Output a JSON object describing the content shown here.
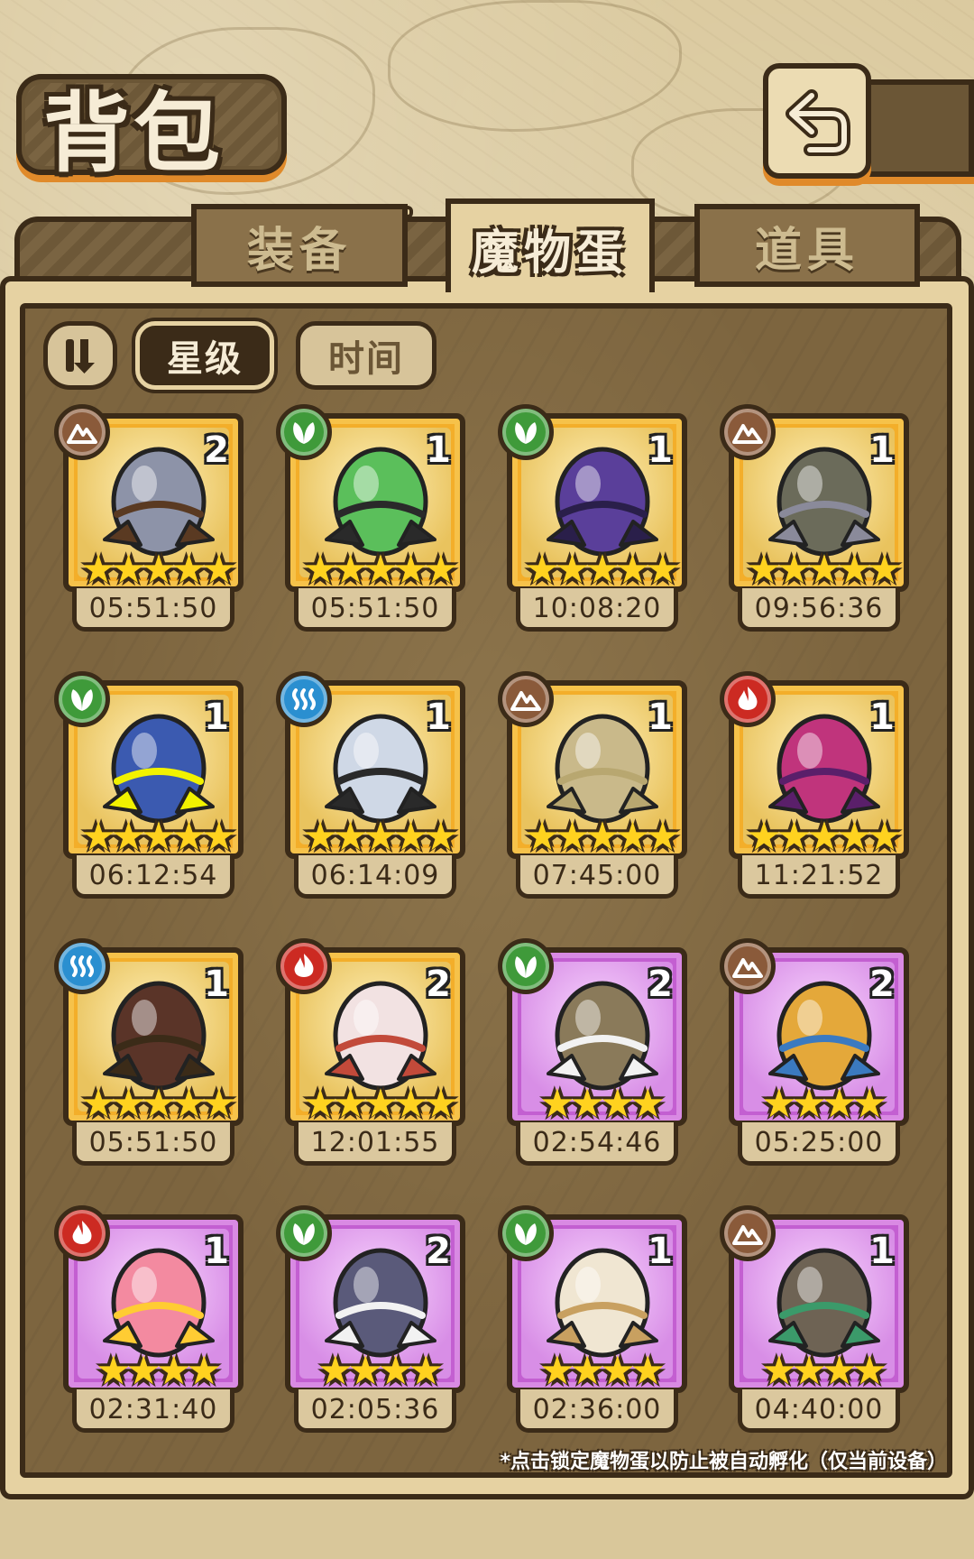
{
  "header": {
    "title": "背包",
    "back_icon": "return-arrow-icon"
  },
  "tabs": [
    {
      "label": "装备",
      "active": false
    },
    {
      "label": "魔物蛋",
      "active": true
    },
    {
      "label": "道具",
      "active": false
    }
  ],
  "sort": {
    "toggle_icon": "sort-order-icon",
    "options": [
      {
        "label": "星级",
        "active": true
      },
      {
        "label": "时间",
        "active": false
      }
    ]
  },
  "colors": {
    "earth": "#8a5a3a",
    "grass": "#3f9a3a",
    "water": "#2a8fd0",
    "fire": "#cc2a22",
    "gold_frame": "#f3ae2a",
    "purple_frame": "#c35fd1"
  },
  "items": [
    {
      "element": "earth",
      "rarity": "gold",
      "stars": 5,
      "count": "2",
      "time": "05:51:50",
      "art": "sword-egg"
    },
    {
      "element": "grass",
      "rarity": "gold",
      "stars": 5,
      "count": "1",
      "time": "05:51:50",
      "art": "lantern-egg"
    },
    {
      "element": "grass",
      "rarity": "gold",
      "stars": 5,
      "count": "1",
      "time": "10:08:20",
      "art": "crystal-egg"
    },
    {
      "element": "earth",
      "rarity": "gold",
      "stars": 5,
      "count": "1",
      "time": "09:56:36",
      "art": "rock-egg"
    },
    {
      "element": "grass",
      "rarity": "gold",
      "stars": 5,
      "count": "1",
      "time": "06:12:54",
      "art": "wing-egg"
    },
    {
      "element": "water",
      "rarity": "gold",
      "stars": 5,
      "count": "1",
      "time": "06:14:09",
      "art": "ice-egg"
    },
    {
      "element": "earth",
      "rarity": "gold",
      "stars": 5,
      "count": "1",
      "time": "07:45:00",
      "art": "pyramid-egg"
    },
    {
      "element": "fire",
      "rarity": "gold",
      "stars": 5,
      "count": "1",
      "time": "11:21:52",
      "art": "orb-egg"
    },
    {
      "element": "water",
      "rarity": "gold",
      "stars": 5,
      "count": "1",
      "time": "05:51:50",
      "art": "staff-egg"
    },
    {
      "element": "fire",
      "rarity": "gold",
      "stars": 5,
      "count": "2",
      "time": "12:01:55",
      "art": "rose-egg"
    },
    {
      "element": "grass",
      "rarity": "purple",
      "stars": 4,
      "count": "2",
      "time": "02:54:46",
      "art": "leaf-egg"
    },
    {
      "element": "earth",
      "rarity": "purple",
      "stars": 4,
      "count": "2",
      "time": "05:25:00",
      "art": "fur-egg"
    },
    {
      "element": "fire",
      "rarity": "purple",
      "stars": 4,
      "count": "1",
      "time": "02:31:40",
      "art": "crown-egg"
    },
    {
      "element": "grass",
      "rarity": "purple",
      "stars": 4,
      "count": "2",
      "time": "02:05:36",
      "art": "spike-egg"
    },
    {
      "element": "grass",
      "rarity": "purple",
      "stars": 4,
      "count": "1",
      "time": "02:36:00",
      "art": "nest-egg"
    },
    {
      "element": "earth",
      "rarity": "purple",
      "stars": 4,
      "count": "1",
      "time": "04:40:00",
      "art": "mole-egg"
    }
  ],
  "hint": "*点击锁定魔物蛋以防止被自动孵化（仅当前设备）"
}
